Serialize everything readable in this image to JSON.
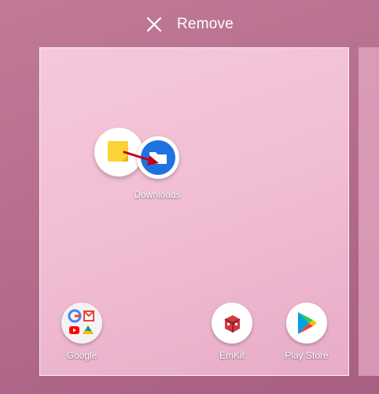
{
  "top_bar": {
    "remove_label": "Remove",
    "icon": "close-icon"
  },
  "home_screen": {
    "folder_label": "Downloads",
    "apps": [
      {
        "label": "Google",
        "icon": "google-folder-icon"
      },
      {
        "label": "EmKit",
        "icon": "emkit-icon"
      },
      {
        "label": "Play Store",
        "icon": "play-store-icon"
      }
    ]
  },
  "colors": {
    "wallpaper": "#b66e8e",
    "panel": "#f3c2d7",
    "downloads_blue": "#1f73e0",
    "notes_yellow": "#fbd336",
    "arrow_red": "#c0001a"
  }
}
